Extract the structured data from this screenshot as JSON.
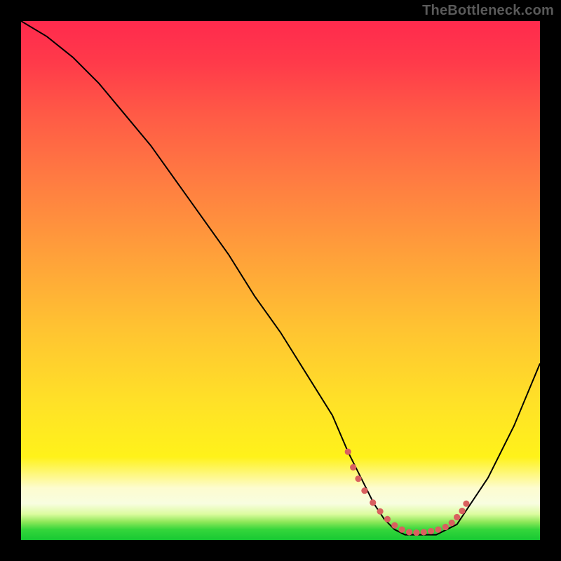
{
  "watermark": "TheBottleneck.com",
  "chart_data": {
    "type": "line",
    "title": "",
    "xlabel": "",
    "ylabel": "",
    "xlim": [
      0,
      100
    ],
    "ylim": [
      0,
      100
    ],
    "series": [
      {
        "name": "bottleneck-curve",
        "x": [
          0,
          5,
          10,
          15,
          20,
          25,
          30,
          35,
          40,
          45,
          50,
          55,
          60,
          63,
          66,
          68,
          70,
          72,
          74,
          76,
          78,
          80,
          82,
          84,
          86,
          90,
          95,
          100
        ],
        "y": [
          100,
          97,
          93,
          88,
          82,
          76,
          69,
          62,
          55,
          47,
          40,
          32,
          24,
          17,
          11,
          7,
          4,
          2,
          1,
          1,
          1,
          1,
          2,
          3,
          6,
          12,
          22,
          34
        ],
        "stroke": "#000000",
        "stroke_width": 2
      }
    ],
    "marker_zone": {
      "name": "optimal-range-dots",
      "color": "#d9605f",
      "radius": 4.6,
      "x": [
        63.0,
        64.0,
        65.0,
        66.2,
        67.8,
        69.2,
        70.6,
        72.0,
        73.4,
        74.8,
        76.2,
        77.6,
        79.0,
        80.4,
        81.8,
        83.0,
        84.0,
        85.0,
        85.8
      ],
      "y": [
        17.0,
        14.0,
        11.8,
        9.5,
        7.2,
        5.5,
        4.0,
        2.8,
        2.0,
        1.5,
        1.4,
        1.5,
        1.7,
        2.0,
        2.5,
        3.3,
        4.4,
        5.6,
        7.0
      ]
    },
    "gradient_stops": [
      {
        "pos": 0,
        "color": "#ff2a4d"
      },
      {
        "pos": 0.45,
        "color": "#ffa03a"
      },
      {
        "pos": 0.84,
        "color": "#fff21a"
      },
      {
        "pos": 0.93,
        "color": "#f8fde0"
      },
      {
        "pos": 1.0,
        "color": "#17c933"
      }
    ]
  }
}
